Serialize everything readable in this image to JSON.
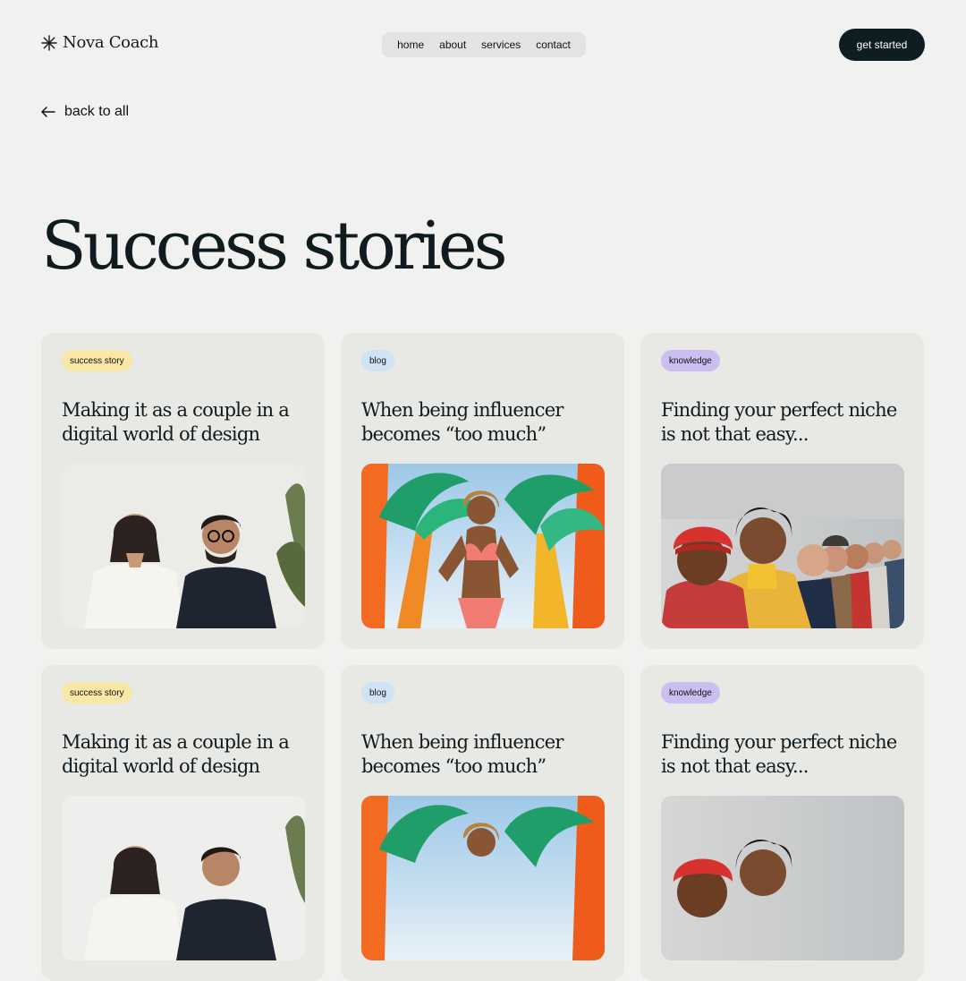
{
  "brand": {
    "name": "Nova Coach",
    "logo_icon": "asterisk-star-icon"
  },
  "nav": {
    "items": [
      {
        "label": "home"
      },
      {
        "label": "about"
      },
      {
        "label": "services"
      },
      {
        "label": "contact"
      }
    ]
  },
  "header": {
    "cta_label": "get started"
  },
  "back_link": {
    "label": "back to all",
    "icon": "arrow-left-icon"
  },
  "page": {
    "title": "Success stories"
  },
  "cards": [
    {
      "tag": "success story",
      "title": "Making it as a couple in a digital world of design",
      "image": "couple-photo"
    },
    {
      "tag": "blog",
      "title": "When being influencer becomes “too much”",
      "image": "inflatable-palm-photo"
    },
    {
      "tag": "knowledge",
      "title": "Finding your perfect niche is not that easy...",
      "image": "crowd-photo"
    },
    {
      "tag": "success story",
      "title": "Making it as a couple in a digital world of design",
      "image": "couple-photo"
    },
    {
      "tag": "blog",
      "title": "When being influencer becomes “too much”",
      "image": "inflatable-palm-photo"
    },
    {
      "tag": "knowledge",
      "title": "Finding your perfect niche is not that easy...",
      "image": "crowd-photo"
    }
  ],
  "colors": {
    "background": "#f1f1ef",
    "card": "#e8e8e5",
    "nav_background": "#e3e4e1",
    "cta_background": "#0d1d22",
    "tag_success_story": "#f9e7a7",
    "tag_blog": "#cfe3f4",
    "tag_knowledge": "#cbbef0",
    "text": "#0f1b1f"
  }
}
